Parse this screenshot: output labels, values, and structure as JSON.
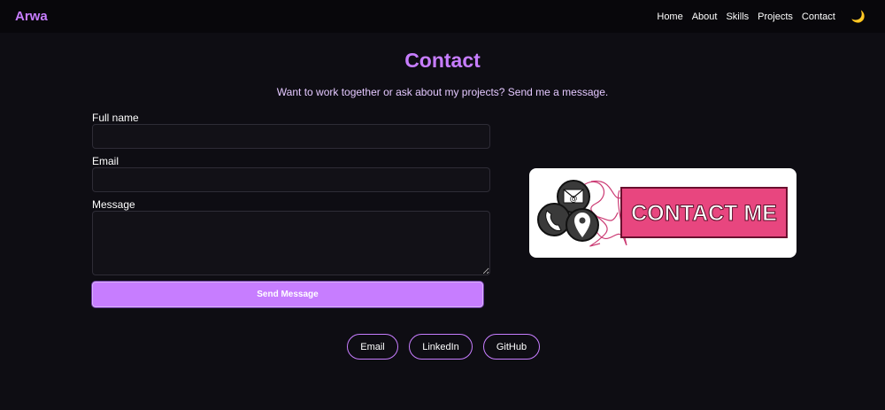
{
  "brand": "Arwa",
  "nav": {
    "items": [
      "Home",
      "About",
      "Skills",
      "Projects",
      "Contact"
    ],
    "theme_icon": "🌙"
  },
  "page": {
    "title": "Contact",
    "subtitle": "Want to work together or ask about my projects? Send me a message."
  },
  "form": {
    "name_label": "Full name",
    "name_value": "",
    "email_label": "Email",
    "email_value": "",
    "message_label": "Message",
    "message_value": "",
    "submit_label": "Send Message"
  },
  "contact_image": {
    "text": "CONTACT ME",
    "icons": [
      "email-icon",
      "phone-icon",
      "location-pin-icon"
    ]
  },
  "socials": [
    "Email",
    "LinkedIn",
    "GitHub"
  ],
  "colors": {
    "background": "#0e0d13",
    "navbar": "#08070b",
    "accent": "#c77dff",
    "contact_pink": "#e8467f"
  }
}
